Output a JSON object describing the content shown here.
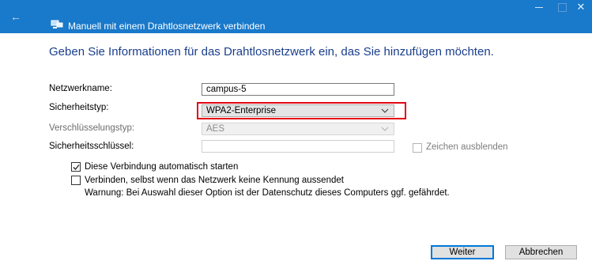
{
  "window": {
    "title": "Manuell mit einem Drahtlosnetzwerk verbinden"
  },
  "heading": "Geben Sie Informationen für das Drahtlosnetzwerk ein, das Sie hinzufügen möchten.",
  "form": {
    "network_name": {
      "label": "Netzwerkname:",
      "value": "campus-5"
    },
    "security_type": {
      "label": "Sicherheitstyp:",
      "value": "WPA2-Enterprise"
    },
    "encryption_type": {
      "label": "Verschlüsselungstyp:",
      "value": "AES"
    },
    "security_key": {
      "label": "Sicherheitsschlüssel:",
      "value": ""
    },
    "hide_chars": {
      "label": "Zeichen ausblenden",
      "checked": false,
      "enabled": false
    },
    "auto_start": {
      "label": "Diese Verbindung automatisch starten",
      "checked": true
    },
    "connect_hidden": {
      "label": "Verbinden, selbst wenn das Netzwerk keine Kennung aussendet",
      "checked": false
    },
    "warning": "Warnung: Bei Auswahl dieser Option ist der Datenschutz dieses Computers ggf. gefährdet."
  },
  "buttons": {
    "next": "Weiter",
    "cancel": "Abbrechen"
  },
  "colors": {
    "titlebar": "#1979ca",
    "heading": "#1a3e8c",
    "highlight": "#e30613",
    "primary_border": "#0078d7"
  }
}
